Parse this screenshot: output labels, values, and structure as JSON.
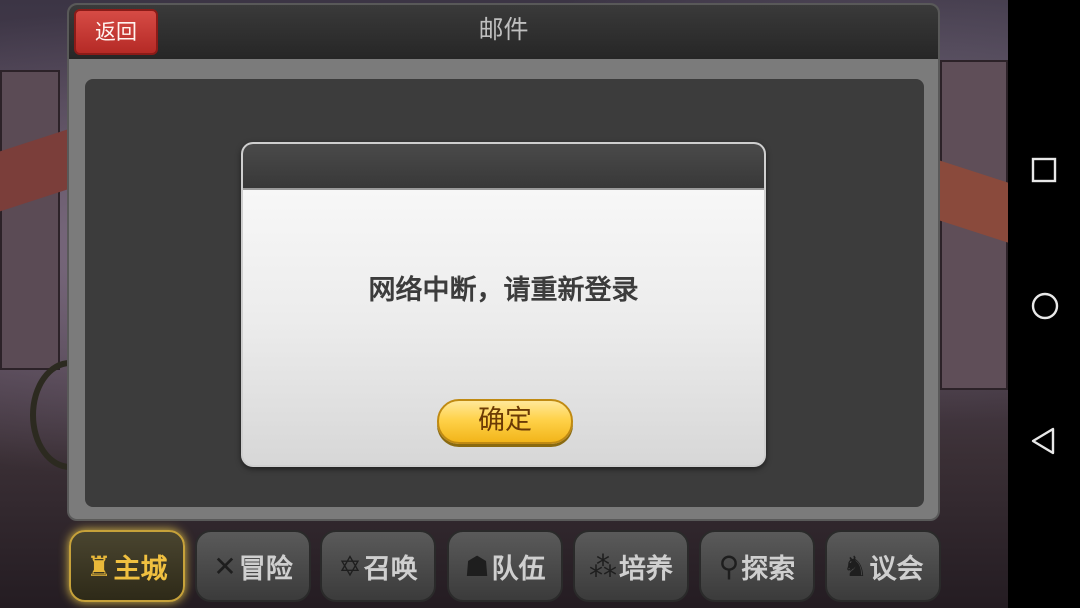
{
  "mail_panel": {
    "back_label": "返回",
    "title": "邮件"
  },
  "dialog": {
    "message": "网络中断，请重新登录",
    "confirm_label": "确定"
  },
  "bottom_nav": {
    "items": [
      {
        "label": "主城",
        "icon": "castle-icon",
        "glyph": "♜",
        "active": true
      },
      {
        "label": "冒险",
        "icon": "crossed-swords-icon",
        "glyph": "✕",
        "active": false
      },
      {
        "label": "召唤",
        "icon": "hexagram-icon",
        "glyph": "✡",
        "active": false
      },
      {
        "label": "队伍",
        "icon": "team-icon",
        "glyph": "☗",
        "active": false
      },
      {
        "label": "培养",
        "icon": "triple-circle-icon",
        "glyph": "⁂",
        "active": false
      },
      {
        "label": "探索",
        "icon": "compass-icon",
        "glyph": "⚲",
        "active": false
      },
      {
        "label": "议会",
        "icon": "knight-icon",
        "glyph": "♞",
        "active": false
      }
    ]
  },
  "system_nav": {
    "buttons": [
      "recent-apps-icon",
      "home-icon",
      "back-icon"
    ]
  },
  "colors": {
    "back_button": "#c6352f",
    "confirm_button": "#ffd24a",
    "active_nav": "#f0c040"
  }
}
